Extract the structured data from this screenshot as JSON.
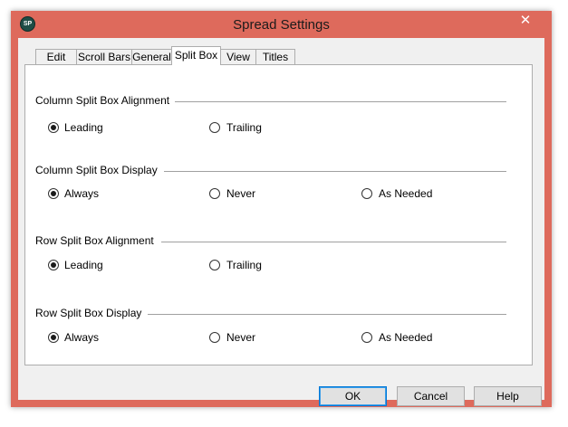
{
  "window": {
    "title": "Spread Settings",
    "icon_text": "SP",
    "close_glyph": "✕"
  },
  "tabs": [
    {
      "label": "Edit"
    },
    {
      "label": "Scroll Bars"
    },
    {
      "label": "General"
    },
    {
      "label": "Split Box",
      "active": true
    },
    {
      "label": "View"
    },
    {
      "label": "Titles"
    }
  ],
  "groups": [
    {
      "label": "Column Split Box Alignment",
      "options": [
        {
          "label": "Leading",
          "checked": true
        },
        {
          "label": "Trailing",
          "checked": false
        }
      ]
    },
    {
      "label": "Column Split Box Display",
      "options": [
        {
          "label": "Always",
          "checked": true
        },
        {
          "label": "Never",
          "checked": false
        },
        {
          "label": "As Needed",
          "checked": false
        }
      ]
    },
    {
      "label": "Row Split Box Alignment",
      "options": [
        {
          "label": "Leading",
          "checked": true
        },
        {
          "label": "Trailing",
          "checked": false
        }
      ]
    },
    {
      "label": "Row Split Box Display",
      "options": [
        {
          "label": "Always",
          "checked": true
        },
        {
          "label": "Never",
          "checked": false
        },
        {
          "label": "As Needed",
          "checked": false
        }
      ]
    }
  ],
  "buttons": {
    "ok": "OK",
    "cancel": "Cancel",
    "help": "Help"
  },
  "colors": {
    "titlebar": "#de6a5c",
    "default_button_border": "#0078d7"
  }
}
